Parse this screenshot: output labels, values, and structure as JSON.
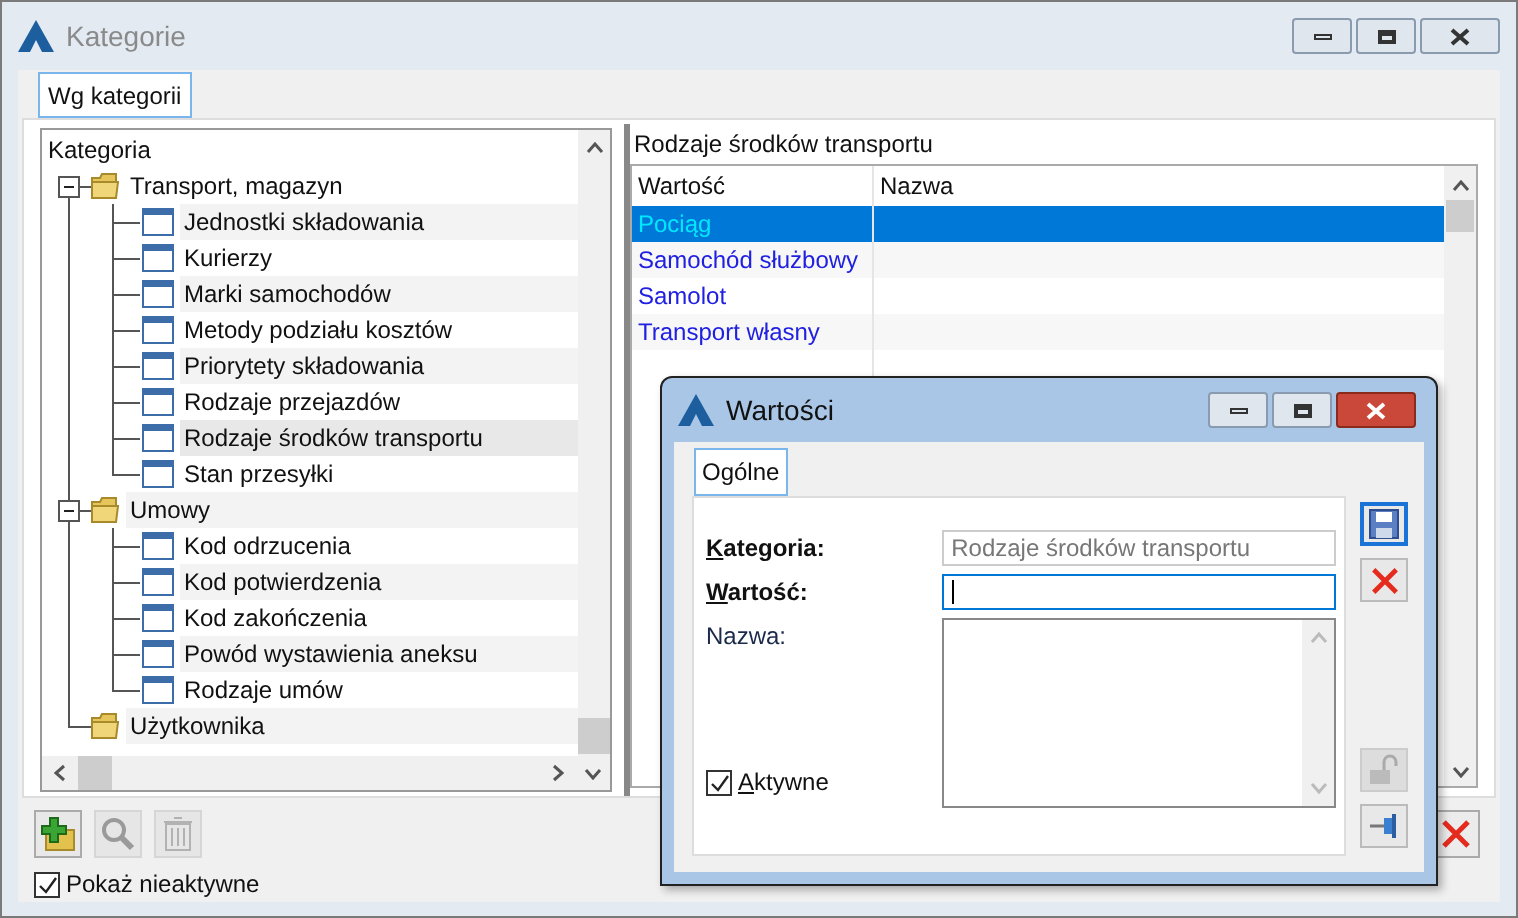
{
  "window": {
    "title": "Kategorie"
  },
  "tabs": [
    {
      "label": "Wg kategorii",
      "selected": true
    }
  ],
  "tree": {
    "header": "Kategoria",
    "items": [
      {
        "label": "Transport, magazyn",
        "kind": "folder",
        "expanded": true,
        "children": [
          {
            "label": "Jednostki składowania",
            "kind": "leaf",
            "selected": false
          },
          {
            "label": "Kurierzy",
            "kind": "leaf",
            "selected": false
          },
          {
            "label": "Marki samochodów",
            "kind": "leaf",
            "selected": false
          },
          {
            "label": "Metody podziału kosztów",
            "kind": "leaf",
            "selected": false
          },
          {
            "label": "Priorytety składowania",
            "kind": "leaf",
            "selected": false
          },
          {
            "label": "Rodzaje przejazdów",
            "kind": "leaf",
            "selected": false
          },
          {
            "label": "Rodzaje środków transportu",
            "kind": "leaf",
            "selected": true
          },
          {
            "label": "Stan przesyłki",
            "kind": "leaf",
            "selected": false
          }
        ]
      },
      {
        "label": "Umowy",
        "kind": "folder",
        "expanded": true,
        "children": [
          {
            "label": "Kod odrzucenia",
            "kind": "leaf",
            "selected": false
          },
          {
            "label": "Kod potwierdzenia",
            "kind": "leaf",
            "selected": false
          },
          {
            "label": "Kod zakończenia",
            "kind": "leaf",
            "selected": false
          },
          {
            "label": "Powód wystawienia aneksu",
            "kind": "leaf",
            "selected": false
          },
          {
            "label": "Rodzaje umów",
            "kind": "leaf",
            "selected": false
          }
        ]
      },
      {
        "label": "Użytkownika",
        "kind": "folder"
      }
    ]
  },
  "grid": {
    "title": "Rodzaje środków transportu",
    "columns": [
      "Wartość",
      "Nazwa"
    ],
    "rows": [
      {
        "value": "Pociąg",
        "selected": true
      },
      {
        "value": "Samochód służbowy",
        "selected": false
      },
      {
        "value": "Samolot",
        "selected": false
      },
      {
        "value": "Transport własny",
        "selected": false
      }
    ]
  },
  "toolbar": [
    {
      "kind": "add",
      "disabled": false
    },
    {
      "kind": "search",
      "disabled": true
    },
    {
      "kind": "delete",
      "disabled": true
    }
  ],
  "show_inactive": {
    "label": "Pokaż nieaktywne",
    "checked": true
  },
  "dialog": {
    "title": "Wartości",
    "tabs": [
      {
        "label": "Ogólne",
        "selected": true
      }
    ],
    "fields": [
      {
        "label": "Kategoria:",
        "kind": "text",
        "required": true,
        "value": "Rodzaje środków transportu",
        "disabled": true
      },
      {
        "label": "Wartość:",
        "kind": "text",
        "required": true,
        "disabled": false
      },
      {
        "label": "Nazwa:",
        "kind": "memo",
        "required": false
      }
    ],
    "active": {
      "label": "Aktywne",
      "checked": true
    }
  }
}
